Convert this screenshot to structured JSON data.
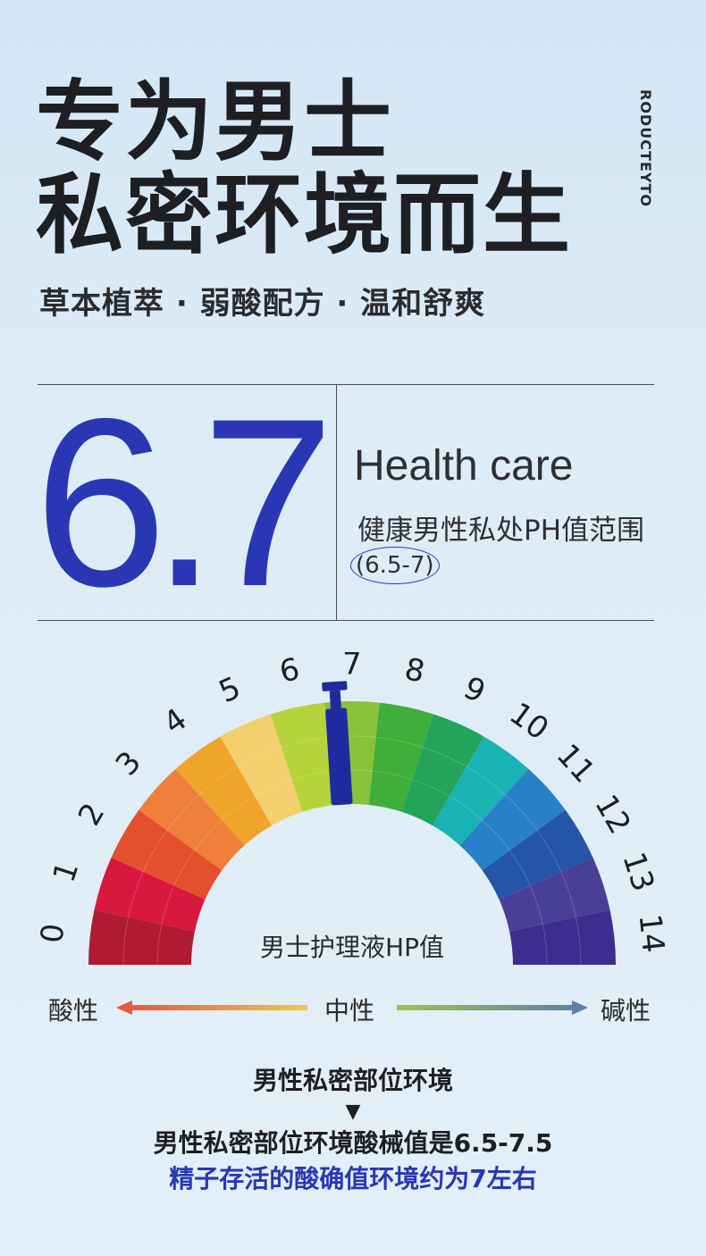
{
  "headline": {
    "line1": "专为男士",
    "line2": "私密环境而生"
  },
  "brand_vertical": {
    "col1": "EYTO",
    "col2": "RODUCT"
  },
  "subtitle": "草本植萃 · 弱酸配方 · 温和舒爽",
  "ph_value": "6.7",
  "health_title": "Health care",
  "range_label": "健康男性私处PH值范围",
  "range_value": "(6.5-7)",
  "gauge": {
    "center_label": "男士护理液HP值",
    "marker_value": 6.7,
    "ticks": [
      "0",
      "1",
      "2",
      "3",
      "4",
      "5",
      "6",
      "7",
      "8",
      "9",
      "10",
      "11",
      "12",
      "13",
      "14"
    ],
    "colors": [
      "#b01a35",
      "#d8183f",
      "#e44f2e",
      "#ef7f3a",
      "#efa42a",
      "#f3cf6e",
      "#b5d33a",
      "#88c23a",
      "#3fae3b",
      "#22a45a",
      "#1ab3b4",
      "#2881c8",
      "#2455a8",
      "#4a3f98",
      "#3d2d8e"
    ],
    "marker_color": "#1f2a9f"
  },
  "scale": {
    "acid": "酸性",
    "neutral": "中性",
    "alkaline": "碱性"
  },
  "info": {
    "title": "男性私密部位环境",
    "arrow": "▼",
    "line1": "男性私密部位环境酸械值是6.5-7.5",
    "line2": "精子存活的酸确值环境约为7左右"
  }
}
